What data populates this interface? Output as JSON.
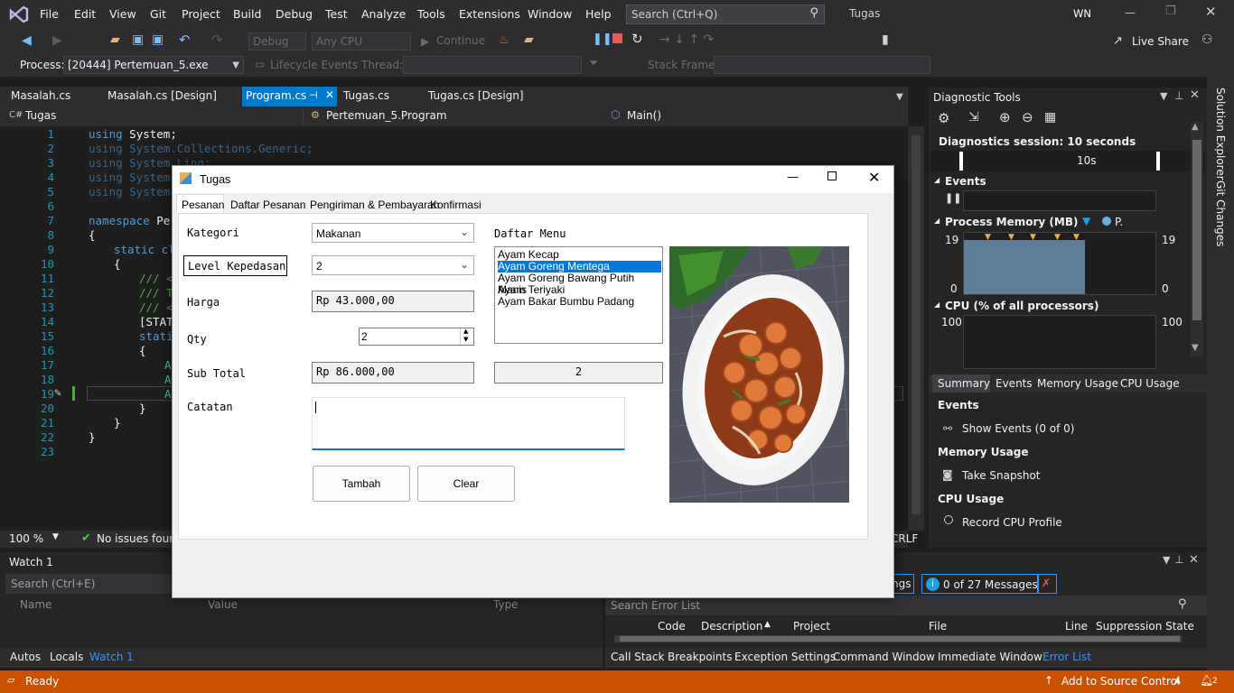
{
  "menu": {
    "items": [
      "File",
      "Edit",
      "View",
      "Git",
      "Project",
      "Build",
      "Debug",
      "Test",
      "Analyze",
      "Tools",
      "Extensions",
      "Window",
      "Help"
    ],
    "search_placeholder": "Search (Ctrl+Q)",
    "solution_name": "Tugas",
    "user_initials": "WN"
  },
  "toolbar": {
    "config": "Debug",
    "platform": "Any CPU",
    "continue_label": "Continue",
    "live_share": "Live Share"
  },
  "procbar": {
    "process_label": "Process:",
    "process_value": "[20444] Pertemuan_5.exe",
    "lifecycle": "Lifecycle Events",
    "thread_label": "Thread:",
    "stackframe_label": "Stack Frame:"
  },
  "editor": {
    "tabs": [
      "Masalah.cs",
      "Masalah.cs [Design]",
      "Program.cs",
      "Tugas.cs",
      "Tugas.cs [Design]"
    ],
    "active_tab": "Program.cs",
    "nav_project": "Tugas",
    "nav_class": "Pertemuan_5.Program",
    "nav_member": "Main()",
    "line_numbers": [
      "1",
      "2",
      "3",
      "4",
      "5",
      "6",
      "7",
      "8",
      "9",
      "10",
      "11",
      "12",
      "13",
      "14",
      "15",
      "16",
      "17",
      "18",
      "19",
      "20",
      "21",
      "22",
      "23"
    ],
    "code": {
      "l1a": "using",
      "l1b": " System;",
      "l2": "using System.Collections.Generic;",
      "l3": "using System.Linq;",
      "l4": "using System.",
      "l5": "using System.",
      "l7a": "namespace",
      "l7b": " Per",
      "l8": "{",
      "l9a": "static",
      "l9b": " cl",
      "l10": "{",
      "l11": "/// <",
      "l12": "/// T",
      "l13": "/// <",
      "l14": "[STAT",
      "l15": "stati",
      "l16": "{",
      "l17": "A",
      "l18": "A",
      "l19": "A",
      "l20": "}",
      "l21": "}",
      "l22": "}"
    },
    "zoom": "100 %",
    "issues": "No issues found",
    "crlf": "CRLF"
  },
  "watch": {
    "title": "Watch 1",
    "search_placeholder": "Search (Ctrl+E)",
    "columns": [
      "Name",
      "Value",
      "Type"
    ],
    "tabs": [
      "Autos",
      "Locals",
      "Watch 1"
    ]
  },
  "error_list": {
    "warnings_label": "ngs",
    "messages": "0 of 27 Messages",
    "search_placeholder": "Search Error List",
    "columns": [
      "Code",
      "Description",
      "Project",
      "File",
      "Line",
      "Suppression State"
    ],
    "tabs": [
      "Call Stack",
      "Breakpoints",
      "Exception Settings",
      "Command Window",
      "Immediate Window",
      "Error List"
    ]
  },
  "diagnostics": {
    "title": "Diagnostic Tools",
    "session": "Diagnostics session: 10 seconds",
    "timeline_tick": "10s",
    "events_label": "Events",
    "memory_label": "Process Memory (MB)",
    "memory_legend": "P.",
    "memory_max": "19",
    "memory_min": "0",
    "cpu_label": "CPU (% of all processors)",
    "cpu_max": "100",
    "cpu_min": "0",
    "tabs": [
      "Summary",
      "Events",
      "Memory Usage",
      "CPU Usage"
    ],
    "section_events": "Events",
    "show_events": "Show Events (0 of 0)",
    "section_memory": "Memory Usage",
    "take_snapshot": "Take Snapshot",
    "section_cpu": "CPU Usage",
    "record_cpu": "Record CPU Profile"
  },
  "side_tabs": [
    "Solution Explorer",
    "Git Changes"
  ],
  "status": {
    "ready": "Ready",
    "source_control": "Add to Source Control",
    "notifications": "2"
  },
  "form": {
    "title": "Tugas",
    "tabs": [
      "Pesanan",
      "Daftar Pesanan",
      "Pengiriman & Pembayaran",
      "Konfirmasi"
    ],
    "kategori_label": "Kategori",
    "kategori_value": "Makanan",
    "level_label": "Level Kepedasan",
    "level_value": "2",
    "harga_label": "Harga",
    "harga_value": "Rp 43.000,00",
    "qty_label": "Qty",
    "qty_value": "2",
    "subtotal_label": "Sub Total",
    "subtotal_value": "Rp 86.000,00",
    "catatan_label": "Catatan",
    "catatan_value": "",
    "menu_label": "Daftar Menu",
    "menu_items": [
      "Ayam Kecap",
      "Ayam Goreng Mentega",
      "Ayam Goreng Bawang Putih Manis",
      "Ayam Teriyaki",
      "Ayam Bakar Bumbu Padang"
    ],
    "selected_index": 1,
    "selected_value_box": "2",
    "tambah_label": "Tambah",
    "clear_label": "Clear",
    "image_alt": "food-photo"
  },
  "colors": {
    "accent": "#007acc",
    "status_bar": "#ca5100",
    "selection": "#0078d7",
    "memory_fill": "#5f7c9a"
  }
}
